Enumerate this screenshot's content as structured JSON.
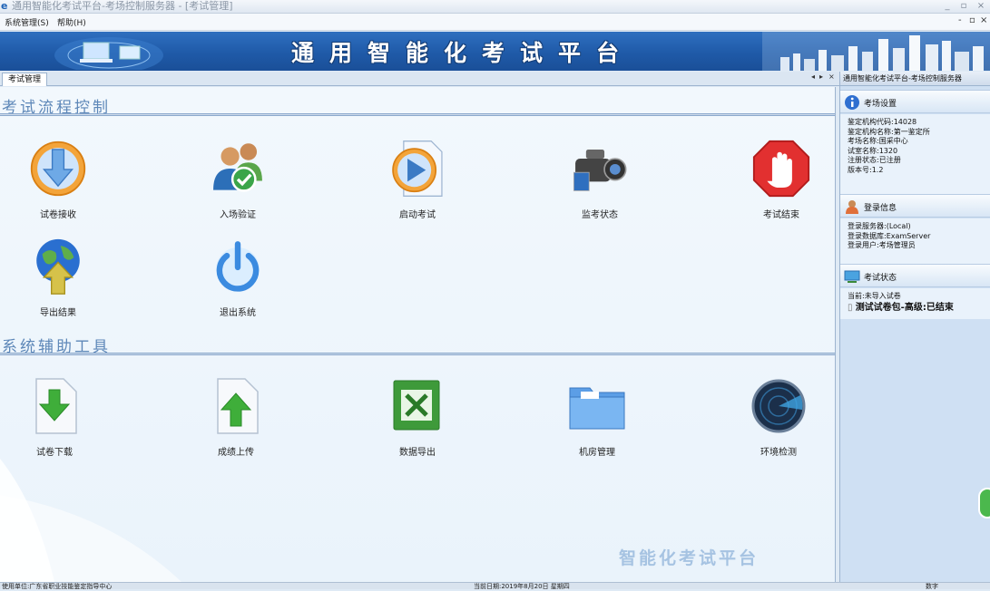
{
  "window": {
    "title": "通用智能化考试平台-考场控制服务器 - [考试管理]",
    "buttons": [
      "_",
      "▫",
      "×"
    ]
  },
  "menubar": {
    "items": [
      "系统管理(S)",
      "帮助(H)"
    ],
    "mdi_controls": [
      "-",
      "▫",
      "×"
    ]
  },
  "banner": {
    "title": "通用智能化考试平台"
  },
  "tabs": {
    "active": "考试管理",
    "controls": [
      "◂",
      "▸",
      "×"
    ]
  },
  "main": {
    "section1_title": "考试流程控制",
    "section2_title": "系统辅助工具",
    "flow_items": [
      {
        "label": "试卷接收",
        "icon": "download-arrow-icon"
      },
      {
        "label": "入场验证",
        "icon": "users-check-icon"
      },
      {
        "label": "启动考试",
        "icon": "play-document-icon"
      },
      {
        "label": "监考状态",
        "icon": "video-camera-icon"
      },
      {
        "label": "考试结束",
        "icon": "stop-hand-icon"
      },
      {
        "label": "导出结果",
        "icon": "globe-upload-icon"
      },
      {
        "label": "退出系统",
        "icon": "power-icon"
      }
    ],
    "tool_items": [
      {
        "label": "试卷下载",
        "icon": "file-download-icon"
      },
      {
        "label": "成绩上传",
        "icon": "file-upload-icon"
      },
      {
        "label": "数据导出",
        "icon": "excel-icon"
      },
      {
        "label": "机房管理",
        "icon": "folder-icon"
      },
      {
        "label": "环境检测",
        "icon": "radar-icon"
      }
    ],
    "watermark": "智能化考试平台"
  },
  "right_panel": {
    "title": "通用智能化考试平台-考场控制服务器",
    "exam_settings": {
      "header": "考场设置",
      "lines": [
        "鉴定机构代码:14028",
        "鉴定机构名称:第一鉴定所",
        "考场名称:国采中心",
        "试室名称:1320",
        "注册状态:已注册",
        "版本号:1.2"
      ]
    },
    "login_info": {
      "header": "登录信息",
      "lines": [
        "登录服务器:(Local)",
        "登录数据库:ExamServer",
        "登录用户:考场管理员"
      ]
    },
    "exam_status": {
      "header": "考试状态",
      "current": "当前:未导入试卷",
      "item": "测试试卷包-高级:已结束"
    }
  },
  "statusbar": {
    "left": "使用单位:广东省职业技能鉴定指导中心",
    "middle": "当前日期:2019年8月20日 星期四",
    "right": "数字"
  },
  "colors": {
    "banner": "#1f5aa8",
    "section_title": "#5d87b8",
    "panel": "#cfe0f3"
  }
}
